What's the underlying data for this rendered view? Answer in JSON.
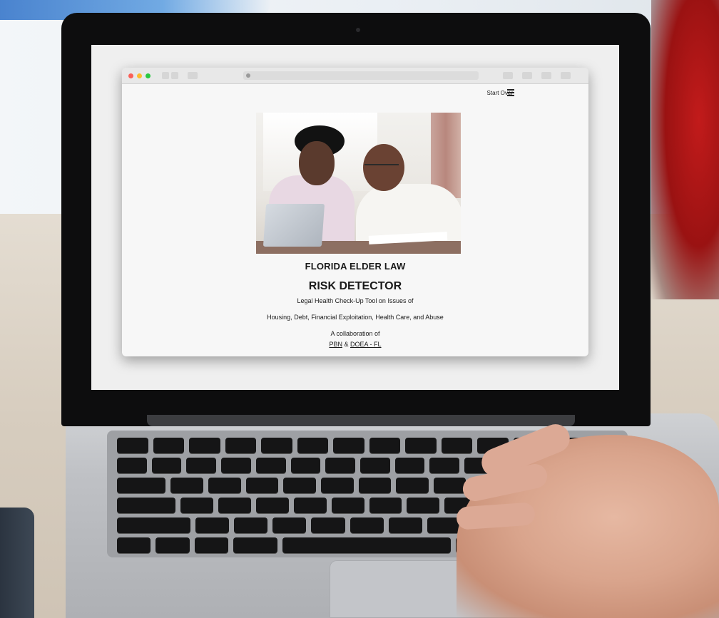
{
  "browser": {
    "nav": {
      "start_over": "Start Over"
    },
    "hero": {
      "title_line1": "FLORIDA ELDER LAW",
      "title_line2": "RISK DETECTOR",
      "subtitle_line1": "Legal Health Check-Up Tool on Issues of",
      "subtitle_line2": "Housing, Debt, Financial Exploitation, Health Care, and Abuse",
      "collab_label": "A collaboration of",
      "partner1": "PBN",
      "amp": "&",
      "partner2": "DOEA - FL"
    }
  },
  "icons": [
    "window-close-icon",
    "window-minimize-icon",
    "window-zoom-icon",
    "hamburger-menu-icon",
    "back-icon",
    "forward-icon",
    "sidebar-icon",
    "share-icon",
    "tabs-icon"
  ],
  "colors": {
    "mac_red": "#fb5f57",
    "mac_yellow": "#fdbc2e",
    "mac_green": "#28c840"
  }
}
